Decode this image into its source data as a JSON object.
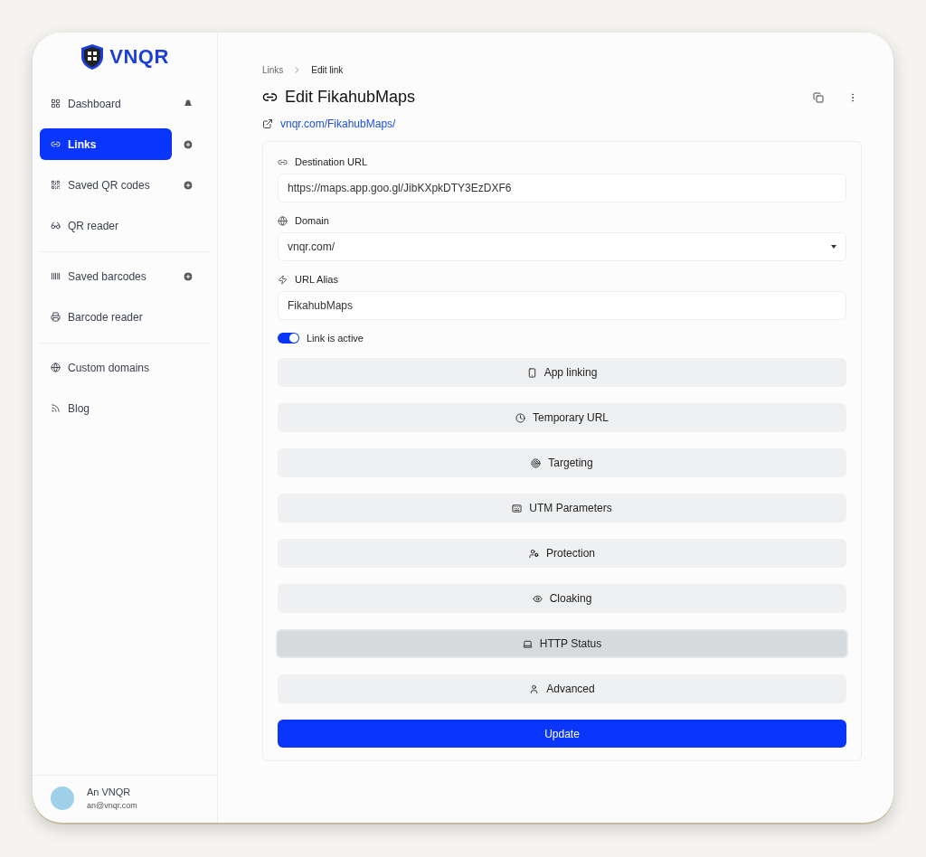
{
  "brand": {
    "name": "VNQR"
  },
  "sidebar": {
    "groups": [
      {
        "items": [
          {
            "label": "Dashboard",
            "selected": false
          },
          {
            "label": "Links",
            "selected": true
          },
          {
            "label": "Saved QR codes",
            "selected": false
          },
          {
            "label": "QR reader",
            "selected": false
          }
        ]
      },
      {
        "items": [
          {
            "label": "Saved barcodes",
            "selected": false
          },
          {
            "label": "Barcode reader",
            "selected": false
          }
        ]
      },
      {
        "items": [
          {
            "label": "Custom domains",
            "selected": false
          },
          {
            "label": "Blog",
            "selected": false
          }
        ]
      }
    ]
  },
  "user": {
    "name": "An VNQR",
    "email": "an@vnqr.com"
  },
  "breadcrumb": [
    "Links",
    "Edit link"
  ],
  "title": "Edit FikahubMaps",
  "short_link": "vnqr.com/FikahubMaps/",
  "form": {
    "fields": [
      {
        "kind": "text",
        "label": "Destination URL",
        "value": "https://maps.app.goo.gl/JibKXpkDTY3EzDXF6"
      },
      {
        "kind": "select",
        "label": "Domain",
        "value": "vnqr.com/"
      },
      {
        "kind": "text",
        "label": "URL Alias",
        "value": "FikahubMaps"
      }
    ],
    "active_toggle": {
      "label": "Link is active",
      "on": true
    },
    "sections": [
      {
        "label": "App linking",
        "selected": false
      },
      {
        "label": "Temporary URL",
        "selected": false
      },
      {
        "label": "Targeting",
        "selected": false
      },
      {
        "label": "UTM Parameters",
        "selected": false
      },
      {
        "label": "Protection",
        "selected": false
      },
      {
        "label": "Cloaking",
        "selected": false
      },
      {
        "label": "HTTP Status",
        "selected": true
      },
      {
        "label": "Advanced",
        "selected": false
      }
    ],
    "submit": "Update"
  }
}
